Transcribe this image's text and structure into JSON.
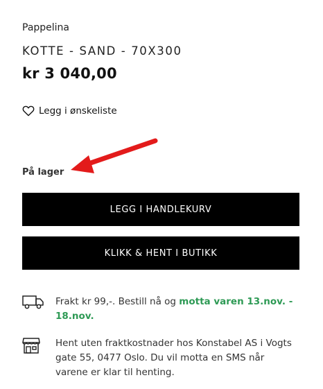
{
  "product": {
    "brand": "Pappelina",
    "title": "KOTTE - SAND - 70X300",
    "price": "kr 3 040,00"
  },
  "wishlist": {
    "label": "Legg i ønskeliste",
    "icon": "heart-outline-icon"
  },
  "stock": {
    "status": "På lager"
  },
  "annotation": {
    "icon": "red-arrow",
    "color": "#e31b1b"
  },
  "buttons": {
    "add_to_cart": "LEGG I HANDLEKURV",
    "click_and_collect": "KLIKK & HENT I BUTIKK"
  },
  "shipping": {
    "icon": "truck-icon",
    "text": "Frakt kr 99,-. Bestill nå og ",
    "highlight": "motta varen 13.nov. - 18.nov.",
    "highlight_color": "#2e9a55"
  },
  "pickup_info": {
    "icon": "store-icon",
    "text": "Hent uten fraktkostnader hos Konstabel AS i Vogts gate 55, 0477 Oslo. Du vil motta en SMS når varene er klar til henting."
  }
}
